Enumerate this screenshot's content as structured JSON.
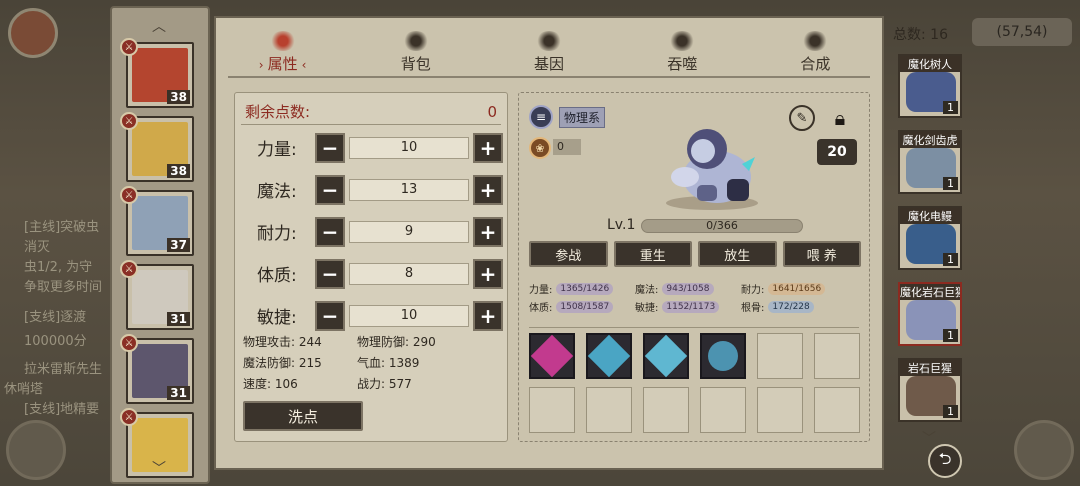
{
  "background": {
    "coord": "(57,54)",
    "chat_lines": [
      "[主线]突破虫",
      "消灭",
      "虫1/2, 为守",
      "争取更多时间",
      "[支线]逐渡",
      "100000分",
      "拉米雷斯先生",
      "休哨塔",
      "[支线]地精要"
    ]
  },
  "tabs": [
    {
      "label": "属性",
      "icon": "flame-icon",
      "active": true
    },
    {
      "label": "背包",
      "icon": "bag-icon",
      "active": false
    },
    {
      "label": "基因",
      "icon": "eye-icon",
      "active": false
    },
    {
      "label": "吞噬",
      "icon": "swirl-icon",
      "active": false
    },
    {
      "label": "合成",
      "icon": "synth-icon",
      "active": false
    }
  ],
  "attributes": {
    "points_label": "剩余点数:",
    "points_value": "0",
    "rows": [
      {
        "label": "力量:",
        "value": "10"
      },
      {
        "label": "魔法:",
        "value": "13"
      },
      {
        "label": "耐力:",
        "value": "9"
      },
      {
        "label": "体质:",
        "value": "8"
      },
      {
        "label": "敏捷:",
        "value": "10"
      }
    ],
    "stats": {
      "phys_atk": "物理攻击: 244",
      "phys_def": "物理防御: 290",
      "mag_def": "魔法防御: 215",
      "hp": "气血: 1389",
      "speed": "速度: 106",
      "power": "战力: 577"
    },
    "reset_label": "洗点"
  },
  "heroes": [
    {
      "level": "38",
      "color": "#b4452f"
    },
    {
      "level": "38",
      "color": "#d0a94a"
    },
    {
      "level": "37",
      "color": "#8fa1b6"
    },
    {
      "level": "31",
      "color": "#cfc9be"
    },
    {
      "level": "31",
      "color": "#5d566d"
    },
    {
      "level": "",
      "color": "#d9b44a"
    }
  ],
  "monster": {
    "type_label": "物理系",
    "paw_value": "0",
    "upgrade_badge": "20",
    "level": "Lv.1",
    "xp": "0/366",
    "actions": [
      "参战",
      "重生",
      "放生",
      "喂 养"
    ],
    "stats": [
      {
        "label": "力量:",
        "value": "1365/1426",
        "tone": "purple"
      },
      {
        "label": "魔法:",
        "value": "943/1058",
        "tone": "purple"
      },
      {
        "label": "耐力:",
        "value": "1641/1656",
        "tone": "orange"
      },
      {
        "label": "体质:",
        "value": "1508/1587",
        "tone": "purple"
      },
      {
        "label": "敏捷:",
        "value": "1152/1173",
        "tone": "purple"
      },
      {
        "label": "根骨:",
        "value": "172/228",
        "tone": "blue"
      }
    ],
    "skills": [
      {
        "color": "#c23a8e"
      },
      {
        "color": "#4aa5c4"
      },
      {
        "color": "#5fb7d1"
      },
      {
        "color": "#4c93b0"
      }
    ]
  },
  "creatures": {
    "total_label": "总数: 16",
    "items": [
      {
        "name": "魔化树人",
        "count": "1",
        "color": "#4a5c8e",
        "selected": false
      },
      {
        "name": "魔化剑齿虎",
        "count": "1",
        "color": "#7c8fa3",
        "selected": false
      },
      {
        "name": "魔化电鳗",
        "count": "1",
        "color": "#395e8b",
        "selected": false
      },
      {
        "name": "魔化岩石巨猩",
        "count": "1",
        "color": "#8a93b8",
        "selected": true
      },
      {
        "name": "岩石巨猩",
        "count": "1",
        "color": "#6f5a4a",
        "selected": false
      }
    ]
  }
}
